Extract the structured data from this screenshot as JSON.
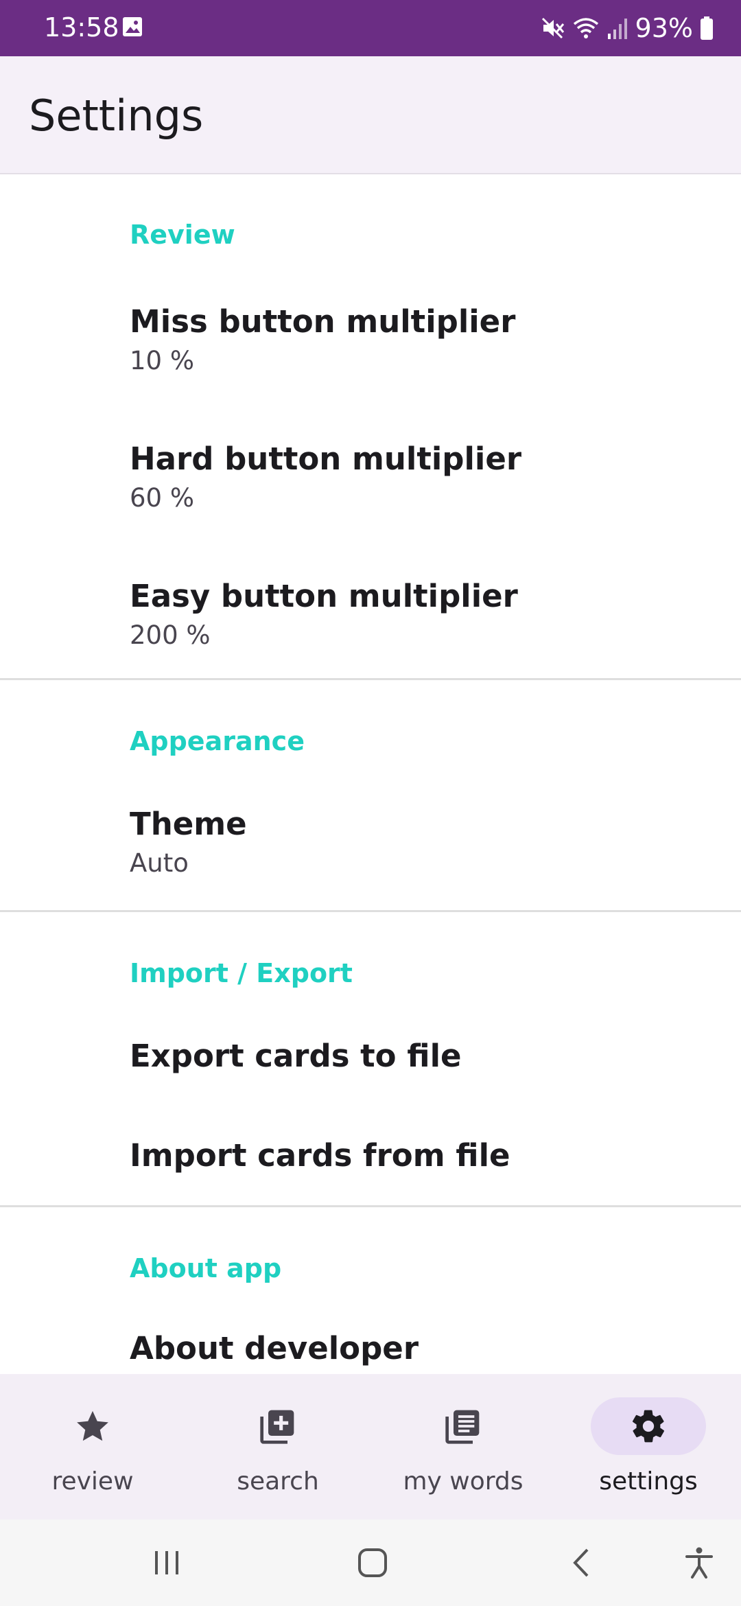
{
  "status_bar": {
    "time": "13:58",
    "battery": "93%",
    "icons": [
      "image-icon",
      "mute-icon",
      "wifi-icon",
      "signal-icon",
      "battery-icon"
    ]
  },
  "app_bar": {
    "title": "Settings"
  },
  "sections": {
    "review": {
      "header": "Review",
      "items": [
        {
          "title": "Miss button multiplier",
          "summary": "10 %"
        },
        {
          "title": "Hard button multiplier",
          "summary": "60 %"
        },
        {
          "title": "Easy button multiplier",
          "summary": "200 %"
        }
      ]
    },
    "appearance": {
      "header": "Appearance",
      "items": [
        {
          "title": "Theme",
          "summary": "Auto"
        }
      ]
    },
    "import_export": {
      "header": "Import / Export",
      "items": [
        {
          "title": "Export cards to file"
        },
        {
          "title": "Import cards from file"
        }
      ]
    },
    "about": {
      "header": "About app",
      "items": [
        {
          "title": "About developer"
        }
      ]
    }
  },
  "bottom_nav": {
    "items": [
      {
        "label": "review",
        "icon": "star-icon",
        "active": false
      },
      {
        "label": "search",
        "icon": "add-box-icon",
        "active": false
      },
      {
        "label": "my words",
        "icon": "library-books-icon",
        "active": false
      },
      {
        "label": "settings",
        "icon": "gear-icon",
        "active": true
      }
    ]
  },
  "system_nav": {
    "icons": [
      "recents-icon",
      "home-icon",
      "back-icon",
      "accessibility-icon"
    ]
  },
  "colors": {
    "status_bar": "#6b2d84",
    "section_header": "#1fd0c1",
    "app_bar_bg": "#f5f0f8",
    "nav_active_pill": "#e7dcf4"
  }
}
